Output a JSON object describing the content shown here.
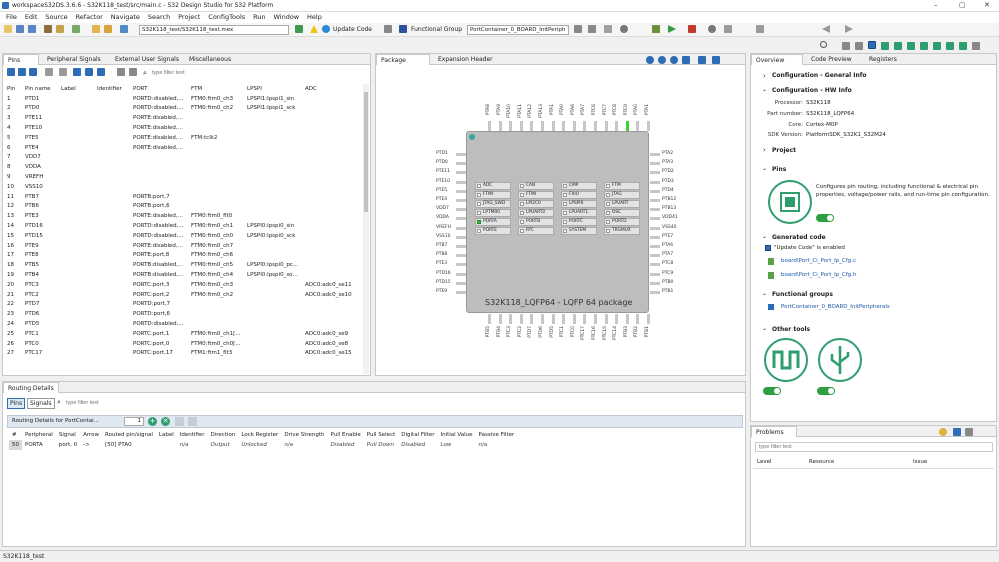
{
  "window": {
    "title": "workspaceS32DS.3.6.6 - S32K118_test/src/main.c - S32 Design Studio for S32 Platform",
    "minimize": "–",
    "maximize": "▢",
    "close": "✕"
  },
  "menu": [
    "File",
    "Edit",
    "Source",
    "Refactor",
    "Navigate",
    "Search",
    "Project",
    "ConfigTools",
    "Run",
    "Window",
    "Help"
  ],
  "toolbar": {
    "config_combo": "S32K118_test/S32K118_test.mex",
    "update_code": "Update Code",
    "functional_group_label": "Functional Group",
    "functional_group_value": "PortContainer_0_BOARD_InitPeriph"
  },
  "left_tabs": [
    "Pins",
    "Peripheral Signals",
    "External User Signals",
    "Miscellaneous"
  ],
  "pins_filter_placeholder": "type filter text",
  "pins_columns": [
    "Pin",
    "Pin name",
    "Label",
    "Identifier",
    "PORT",
    "FTM",
    "LPSPI",
    "ADC"
  ],
  "pins_rows": [
    [
      "1",
      "PTD1",
      "",
      "",
      "PORTD:disabled,...",
      "FTM0:ftm0_ch3",
      "LPSPI1:lpspi1_sin",
      ""
    ],
    [
      "2",
      "PTD0",
      "",
      "",
      "PORTD:disabled,...",
      "FTM0:ftm0_ch2",
      "LPSPI1:lpspi1_sck",
      ""
    ],
    [
      "3",
      "PTE11",
      "",
      "",
      "PORTE:disabled,...",
      "",
      "",
      ""
    ],
    [
      "4",
      "PTE10",
      "",
      "",
      "PORTE:disabled,...",
      "",
      "",
      ""
    ],
    [
      "5",
      "PTE5",
      "",
      "",
      "PORTE:disabled,...",
      "FTM:tclk2",
      "",
      ""
    ],
    [
      "6",
      "PTE4",
      "",
      "",
      "PORTE:disabled,...",
      "",
      "",
      ""
    ],
    [
      "7",
      "VDD7",
      "",
      "",
      "",
      "",
      "",
      ""
    ],
    [
      "8",
      "VDDA",
      "",
      "",
      "",
      "",
      "",
      ""
    ],
    [
      "9",
      "VREFH",
      "",
      "",
      "",
      "",
      "",
      ""
    ],
    [
      "10",
      "VSS10",
      "",
      "",
      "",
      "",
      "",
      ""
    ],
    [
      "11",
      "PTB7",
      "",
      "",
      "PORTB:port,7",
      "",
      "",
      ""
    ],
    [
      "12",
      "PTB6",
      "",
      "",
      "PORTB:port,6",
      "",
      "",
      ""
    ],
    [
      "13",
      "PTE3",
      "",
      "",
      "PORTE:disabled,...",
      "FTM0:ftm0_flt0",
      "",
      ""
    ],
    [
      "14",
      "PTD16",
      "",
      "",
      "PORTD:disabled,...",
      "FTM0:ftm0_ch1",
      "LPSPI0:lpspi0_sin",
      ""
    ],
    [
      "15",
      "PTD15",
      "",
      "",
      "PORTD:disabled,...",
      "FTM0:ftm0_ch0",
      "LPSPI0:lpspi0_sck",
      ""
    ],
    [
      "16",
      "PTE9",
      "",
      "",
      "PORTE:disabled,...",
      "FTM0:ftm0_ch7",
      "",
      ""
    ],
    [
      "17",
      "PTE8",
      "",
      "",
      "PORTE:port,8",
      "FTM0:ftm0_ch6",
      "",
      ""
    ],
    [
      "18",
      "PTB5",
      "",
      "",
      "PORTB:disabled,...",
      "FTM0:ftm0_ch5",
      "LPSPI0:lpspi0_pc...",
      ""
    ],
    [
      "19",
      "PTB4",
      "",
      "",
      "PORTB:disabled,...",
      "FTM0:ftm0_ch4",
      "LPSPI0:lpspi0_so...",
      ""
    ],
    [
      "20",
      "PTC3",
      "",
      "",
      "PORTC:port,3",
      "FTM0:ftm0_ch3",
      "",
      "ADC0:adc0_se11"
    ],
    [
      "21",
      "PTC2",
      "",
      "",
      "PORTC:port,2",
      "FTM0:ftm0_ch2",
      "",
      "ADC0:adc0_se10"
    ],
    [
      "22",
      "PTD7",
      "",
      "",
      "PORTD:port,7",
      "",
      "",
      ""
    ],
    [
      "23",
      "PTD6",
      "",
      "",
      "PORTD:port,6",
      "",
      "",
      ""
    ],
    [
      "24",
      "PTD5",
      "",
      "",
      "PORTD:disabled,...",
      "",
      "",
      ""
    ],
    [
      "25",
      "PTC1",
      "",
      "",
      "PORTC:port,1",
      "FTM0:ftm0_ch1[...",
      "",
      "ADC0:adc0_se9"
    ],
    [
      "26",
      "PTC0",
      "",
      "",
      "PORTC:port,0",
      "FTM0:ftm0_ch0[...",
      "",
      "ADC0:adc0_se8"
    ],
    [
      "27",
      "PTC17",
      "",
      "",
      "PORTC:port,17",
      "FTM1:ftm1_flt3",
      "",
      "ADC0:adc0_se15"
    ]
  ],
  "center_tabs": [
    "Package",
    "Expansion Header"
  ],
  "package": {
    "label": "S32K118_LQFP64 - LQFP 64 package",
    "top_pins": [
      "PTA8",
      "PTA9",
      "PTA10",
      "PTA11",
      "PTA12",
      "PTA13",
      "PTA1",
      "PTA0",
      "PTA6",
      "PTA7",
      "PTC6",
      "PTC7",
      "PTC8",
      "PTC9",
      "PTA0",
      "PTA1"
    ],
    "left_pins": [
      "PTD1",
      "PTD0",
      "PTE11",
      "PTE10",
      "PTE5",
      "PTE4",
      "VDD7",
      "VDDA",
      "VREFH",
      "VSS10",
      "PTB7",
      "PTB6",
      "PTE3",
      "PTD16",
      "PTD15",
      "PTE9"
    ],
    "right_pins": [
      "PTA2",
      "PTA3",
      "PTD2",
      "PTD3",
      "PTD4",
      "PTB12",
      "PTB13",
      "VDD41",
      "VSS40",
      "PTE7",
      "PTA6",
      "PTA7",
      "PTC8",
      "PTC9",
      "PTB0",
      "PTB1"
    ],
    "bottom_pins": [
      "PTB5",
      "PTB4",
      "PTC3",
      "PTC2",
      "PTD7",
      "PTD6",
      "PTD5",
      "PTC1",
      "PTC0",
      "PTC17",
      "PTC16",
      "PTC15",
      "PTC14",
      "PTB3",
      "PTB2",
      "PTB1"
    ],
    "modules": [
      "ADC",
      "CAN",
      "CMP",
      "FTM",
      "FTMI",
      "FTMI",
      "FXIO",
      "JTAG",
      "JTAG_SWD",
      "LPI2C0",
      "LPSPI0",
      "LPUART",
      "LPTMR0",
      "LPUART0",
      "LPUART1",
      "OSC",
      "PORTA",
      "PORTB",
      "PORTC",
      "PORTD",
      "PORTE",
      "RTC",
      "SYSTEM",
      "TRGMUX"
    ]
  },
  "right_tabs": [
    "Overview",
    "Code Preview",
    "Registers"
  ],
  "overview": {
    "general": "Configuration - General Info",
    "hw": "Configuration - HW Info",
    "processor_label": "Processor:",
    "processor": "S32K118",
    "part_label": "Part number:",
    "part": "S32K118_LQFP64",
    "core_label": "Core:",
    "core": "Cortex-M0P",
    "sdk_label": "SDK Version:",
    "sdk": "PlatformSDK_S32K1_S32M24",
    "project": "Project",
    "pins": "Pins",
    "pins_desc": "Configures pin routing, including functional & electrical pin properties, voltage/power rails, and run-time pin configuration.",
    "generated": "Generated code",
    "update_enabled": "\"Update Code\" is enabled",
    "file1": "board\\Port_Ci_Port_Ip_Cfg.c",
    "file2": "board\\Port_Ci_Port_Ip_Cfg.h",
    "fgroups": "Functional groups",
    "fgroup1": "PortContainer_0_BOARD_InitPeripherals",
    "other": "Other tools"
  },
  "routing": {
    "tab": "Routing Details",
    "btn_pins": "Pins",
    "btn_signals": "Signals",
    "filter": "type filter text",
    "for_label": "Routing Details for PortContai...",
    "count": "1",
    "columns": [
      "#",
      "Peripheral",
      "Signal",
      "Arrow",
      "Routed pin/signal",
      "Label",
      "Identifier",
      "Direction",
      "Lock Register",
      "Drive Strength",
      "Pull Enable",
      "Pull Select",
      "Digital Filter",
      "Initial Value",
      "Passive Filter"
    ],
    "row": [
      "50",
      "PORTA",
      "port, 0",
      "->",
      "[50] PTA0",
      "",
      "n/a",
      "Output",
      "Unlocked",
      "n/a",
      "Disabled",
      "Pull Down",
      "Disabled",
      "Low",
      "n/a"
    ]
  },
  "problems": {
    "tab": "Problems",
    "filter": "type filter text",
    "columns": [
      "Level",
      "Resource",
      "Issue"
    ]
  },
  "status": "S32K118_test"
}
